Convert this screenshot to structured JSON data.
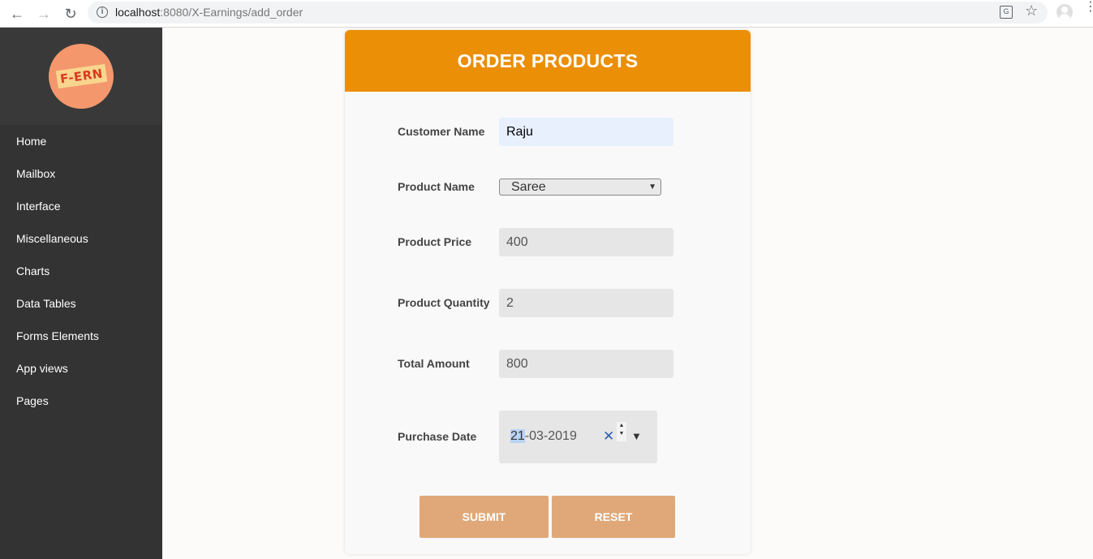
{
  "browser": {
    "url_host": "localhost",
    "url_rest": ":8080/X-Earnings/add_order"
  },
  "sidebar": {
    "logo_text": "F-ERN",
    "items": [
      {
        "label": "Home"
      },
      {
        "label": "Mailbox"
      },
      {
        "label": "Interface"
      },
      {
        "label": "Miscellaneous"
      },
      {
        "label": "Charts"
      },
      {
        "label": "Data Tables"
      },
      {
        "label": "Forms Elements"
      },
      {
        "label": "App views"
      },
      {
        "label": "Pages"
      }
    ]
  },
  "form": {
    "title": "ORDER PRODUCTS",
    "customer_name": {
      "label": "Customer Name",
      "value": "Raju"
    },
    "product_name": {
      "label": "Product Name",
      "value": "Saree"
    },
    "product_price": {
      "label": "Product Price",
      "value": "400"
    },
    "product_quantity": {
      "label": "Product Quantity",
      "value": "2"
    },
    "total_amount": {
      "label": "Total Amount",
      "value": "800"
    },
    "purchase_date": {
      "label": "Purchase Date",
      "day": "21",
      "rest": "-03-2019"
    },
    "submit_label": "SUBMIT",
    "reset_label": "RESET"
  },
  "colors": {
    "header": "#eb8f07",
    "button": "#e0a878",
    "sidebar": "#333333"
  }
}
